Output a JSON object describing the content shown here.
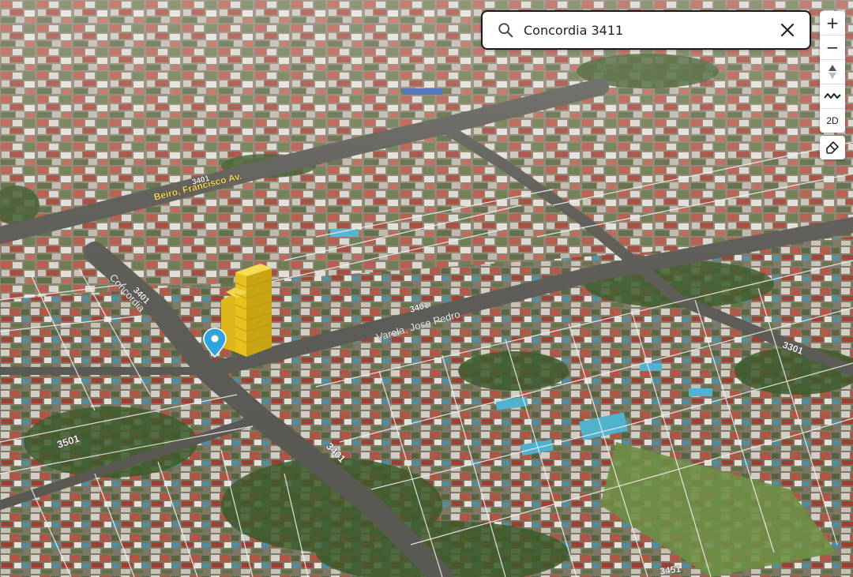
{
  "search": {
    "value": "Concordia 3411"
  },
  "toolbar": {
    "zoom_in": "+",
    "zoom_out": "−",
    "view_2d": "2D"
  },
  "map": {
    "street_labels": {
      "beiro": "Beiro, Francisco Av.",
      "concordia": "Concordia",
      "varela": "Varela, Jose Pedro"
    },
    "number_labels": {
      "n3401_top": "3401",
      "n3401_concordia": "3401",
      "n3401_varela": "3401",
      "n3301_right": "3301",
      "n3501_left": "3501",
      "n3401_bottom": "3401",
      "n3451_bottom": "3451"
    },
    "colors": {
      "building_highlight": "#e7c21f",
      "marker": "#2fa4dc"
    }
  }
}
